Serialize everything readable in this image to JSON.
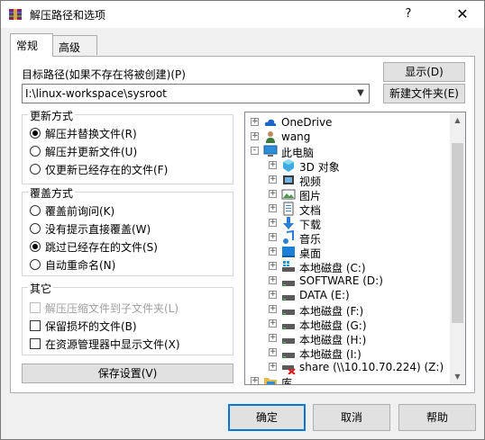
{
  "window": {
    "title": "解压路径和选项",
    "help_glyph": "?",
    "close_glyph": "✕"
  },
  "tabs": [
    {
      "label": "常规",
      "active": true
    },
    {
      "label": "高级",
      "active": false
    }
  ],
  "path": {
    "label": "目标路径(如果不存在将被创建)(P)",
    "value": "I:\\linux-workspace\\sysroot"
  },
  "buttons": {
    "show": "显示(D)",
    "new_folder": "新建文件夹(E)",
    "save_settings": "保存设置(V)",
    "ok": "确定",
    "cancel": "取消",
    "help": "帮助"
  },
  "update_mode": {
    "title": "更新方式",
    "options": [
      {
        "label": "解压并替换文件(R)",
        "selected": true
      },
      {
        "label": "解压并更新文件(U)",
        "selected": false
      },
      {
        "label": "仅更新已经存在的文件(F)",
        "selected": false
      }
    ]
  },
  "overwrite_mode": {
    "title": "覆盖方式",
    "options": [
      {
        "label": "覆盖前询问(K)",
        "selected": false
      },
      {
        "label": "没有提示直接覆盖(W)",
        "selected": false
      },
      {
        "label": "跳过已经存在的文件(S)",
        "selected": true
      },
      {
        "label": "自动重命名(N)",
        "selected": false
      }
    ]
  },
  "other": {
    "title": "其它",
    "options": [
      {
        "label": "解压压缩文件到子文件夹(L)",
        "checked": false,
        "disabled": true
      },
      {
        "label": "保留损坏的文件(B)",
        "checked": false,
        "disabled": false
      },
      {
        "label": "在资源管理器中显示文件(X)",
        "checked": false,
        "disabled": false
      }
    ]
  },
  "tree": {
    "nodes": [
      {
        "label": "OneDrive",
        "icon": "cloud-icon",
        "level": 0,
        "expander": "+"
      },
      {
        "label": "wang",
        "icon": "user-icon",
        "level": 0,
        "expander": "+"
      },
      {
        "label": "此电脑",
        "icon": "computer-icon",
        "level": 0,
        "expander": "-"
      },
      {
        "label": "3D 对象",
        "icon": "3d-objects-icon",
        "level": 1,
        "expander": "+"
      },
      {
        "label": "视频",
        "icon": "video-icon",
        "level": 1,
        "expander": "+"
      },
      {
        "label": "图片",
        "icon": "pictures-icon",
        "level": 1,
        "expander": "+"
      },
      {
        "label": "文档",
        "icon": "documents-icon",
        "level": 1,
        "expander": "+"
      },
      {
        "label": "下载",
        "icon": "download-icon",
        "level": 1,
        "expander": "+"
      },
      {
        "label": "音乐",
        "icon": "music-icon",
        "level": 1,
        "expander": "+"
      },
      {
        "label": "桌面",
        "icon": "desktop-icon",
        "level": 1,
        "expander": "+"
      },
      {
        "label": "本地磁盘 (C:)",
        "icon": "system-drive-icon",
        "level": 1,
        "expander": "+"
      },
      {
        "label": "SOFTWARE (D:)",
        "icon": "drive-icon",
        "level": 1,
        "expander": "+"
      },
      {
        "label": "DATA (E:)",
        "icon": "drive-icon",
        "level": 1,
        "expander": "+"
      },
      {
        "label": "本地磁盘 (F:)",
        "icon": "drive-icon",
        "level": 1,
        "expander": "+"
      },
      {
        "label": "本地磁盘 (G:)",
        "icon": "drive-icon",
        "level": 1,
        "expander": "+"
      },
      {
        "label": "本地磁盘 (H:)",
        "icon": "drive-icon",
        "level": 1,
        "expander": "+"
      },
      {
        "label": "本地磁盘 (I:)",
        "icon": "drive-icon",
        "level": 1,
        "expander": "+"
      },
      {
        "label": "share (\\\\10.10.70.224) (Z:)",
        "icon": "network-drive-disconnected-icon",
        "level": 1,
        "expander": "+"
      },
      {
        "label": "库",
        "icon": "library-icon",
        "level": 0,
        "expander": "+"
      }
    ]
  },
  "colors": {
    "accent": "#0078d7",
    "folder": "#e8b84a",
    "cloud": "#1c64c8",
    "monitor": "#2a8fd8"
  }
}
